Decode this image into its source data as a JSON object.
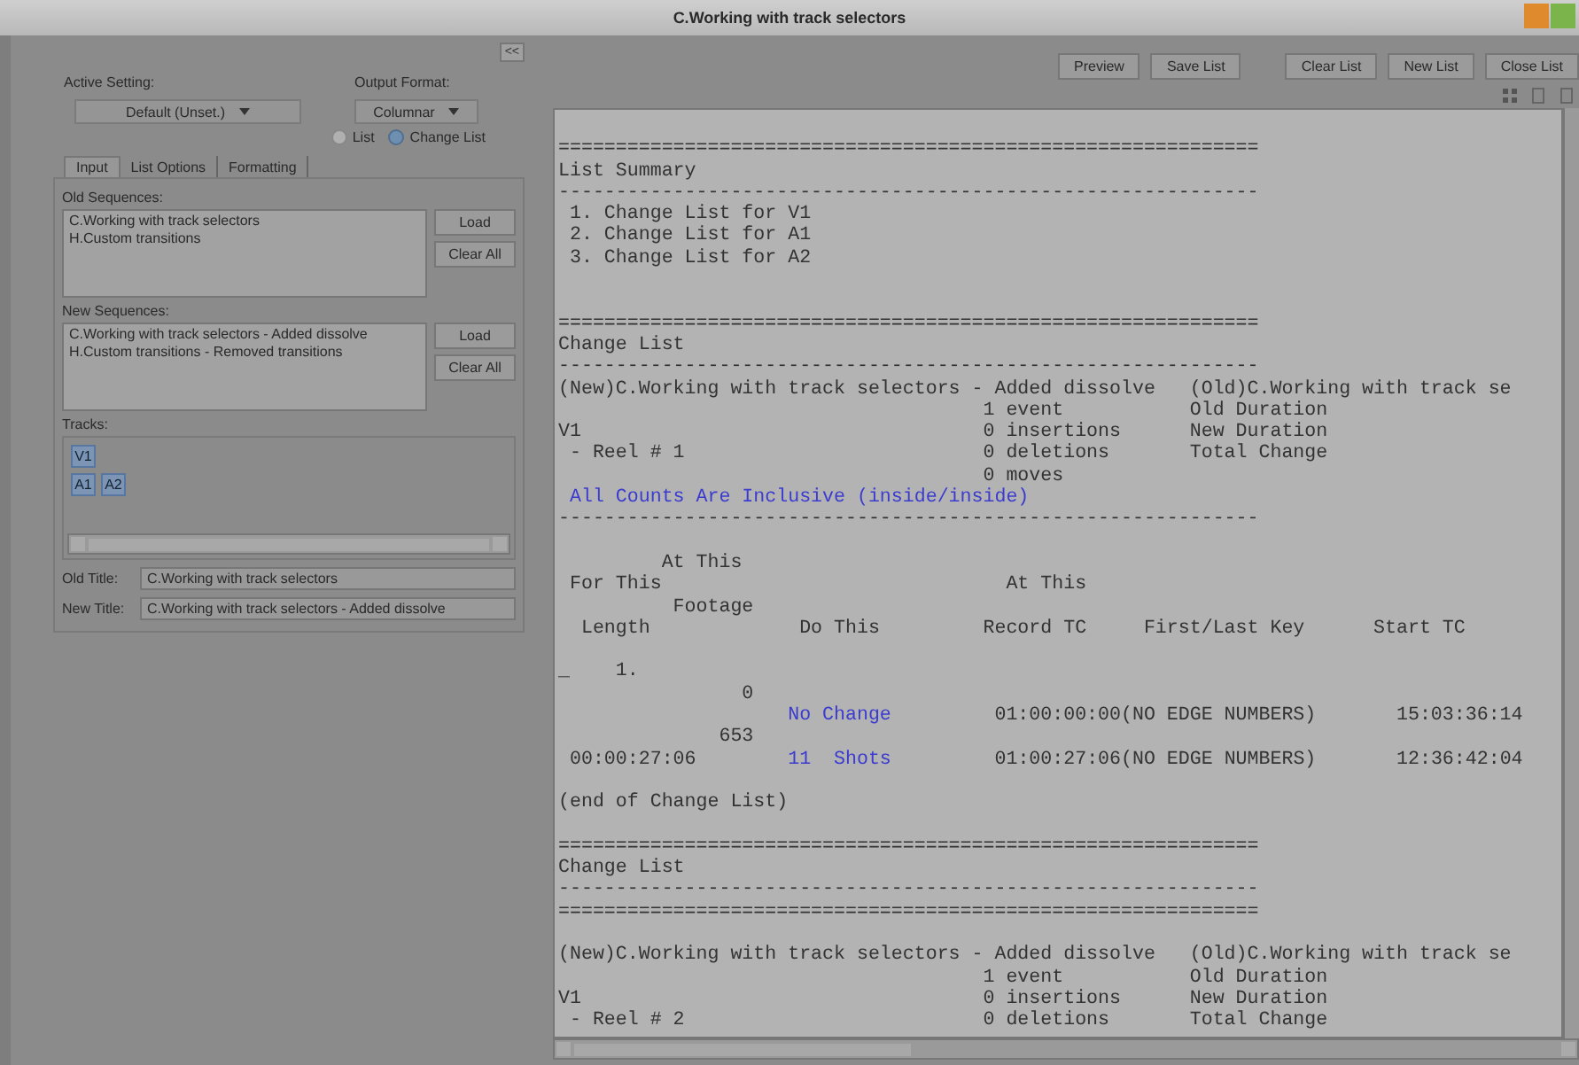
{
  "window": {
    "title": "C.Working with track selectors"
  },
  "collapse_button": "<<",
  "settings": [
    {
      "label": "Active Setting:",
      "value": "Default (Unset.)"
    },
    {
      "label": "Output Format:",
      "value": "Columnar"
    }
  ],
  "radios": [
    {
      "label": "List",
      "selected": false
    },
    {
      "label": "Change List",
      "selected": true
    }
  ],
  "tabs": [
    {
      "label": "Input",
      "selected": true
    },
    {
      "label": "List Options",
      "selected": false
    },
    {
      "label": "Formatting",
      "selected": false
    }
  ],
  "sequences": [
    {
      "label": "Old Sequences:",
      "items": [
        "C.Working with track selectors",
        "H.Custom transitions"
      ],
      "buttons": [
        "Load",
        "Clear All"
      ]
    },
    {
      "label": "New Sequences:",
      "items": [
        "C.Working with track selectors - Added dissolve",
        "H.Custom transitions - Removed transitions"
      ],
      "buttons": [
        "Load",
        "Clear All"
      ]
    }
  ],
  "tracks": {
    "label": "Tracks:",
    "rows": [
      [
        {
          "label": "V1",
          "selected": true
        }
      ],
      [
        {
          "label": "A1",
          "selected": true
        },
        {
          "label": "A2",
          "selected": true
        }
      ]
    ]
  },
  "titles": [
    {
      "label": "Old Title:",
      "value": "C.Working with track selectors"
    },
    {
      "label": "New Title:",
      "value": "C.Working with track selectors - Added dissolve"
    }
  ],
  "toolbar": {
    "left": [
      "Preview",
      "Save List"
    ],
    "right": [
      "Clear List",
      "New List",
      "Close List"
    ]
  },
  "report": {
    "lines": [
      {
        "kind": "blank"
      },
      {
        "kind": "text",
        "segments": [
          {
            "text": "=============================================================",
            "kind": "plain"
          }
        ]
      },
      {
        "kind": "text",
        "segments": [
          {
            "text": "List Summary",
            "kind": "plain"
          }
        ]
      },
      {
        "kind": "text",
        "segments": [
          {
            "text": "-------------------------------------------------------------",
            "kind": "plain"
          }
        ]
      },
      {
        "kind": "text",
        "segments": [
          {
            "text": " 1. Change List for V1",
            "kind": "plain"
          }
        ]
      },
      {
        "kind": "text",
        "segments": [
          {
            "text": " 2. Change List for A1",
            "kind": "plain"
          }
        ]
      },
      {
        "kind": "text",
        "segments": [
          {
            "text": " 3. Change List for A2",
            "kind": "plain"
          }
        ]
      },
      {
        "kind": "blank"
      },
      {
        "kind": "blank"
      },
      {
        "kind": "text",
        "segments": [
          {
            "text": "=============================================================",
            "kind": "plain"
          }
        ]
      },
      {
        "kind": "text",
        "segments": [
          {
            "text": "Change List",
            "kind": "plain"
          }
        ]
      },
      {
        "kind": "text",
        "segments": [
          {
            "text": "-------------------------------------------------------------",
            "kind": "plain"
          }
        ]
      },
      {
        "kind": "text",
        "segments": [
          {
            "text": "(New)C.Working with track selectors - Added dissolve   (Old)C.Working with track se",
            "kind": "plain"
          }
        ]
      },
      {
        "kind": "text",
        "segments": [
          {
            "text": "                                     1 event           Old Duration",
            "kind": "plain"
          }
        ]
      },
      {
        "kind": "text",
        "segments": [
          {
            "text": "V1                                   0 insertions      New Duration",
            "kind": "plain"
          }
        ]
      },
      {
        "kind": "text",
        "segments": [
          {
            "text": " - Reel # 1                          0 deletions       Total Change",
            "kind": "plain"
          }
        ]
      },
      {
        "kind": "text",
        "segments": [
          {
            "text": "                                     0 moves",
            "kind": "plain"
          }
        ]
      },
      {
        "kind": "text",
        "segments": [
          {
            "text": " All Counts Are Inclusive (inside/inside)",
            "kind": "highlight"
          }
        ]
      },
      {
        "kind": "text",
        "segments": [
          {
            "text": "-------------------------------------------------------------",
            "kind": "plain"
          }
        ]
      },
      {
        "kind": "blank"
      },
      {
        "kind": "text",
        "segments": [
          {
            "text": "         At This",
            "kind": "plain"
          }
        ]
      },
      {
        "kind": "text",
        "segments": [
          {
            "text": " For This                              At This",
            "kind": "plain"
          }
        ]
      },
      {
        "kind": "text",
        "segments": [
          {
            "text": "          Footage",
            "kind": "plain"
          }
        ]
      },
      {
        "kind": "text",
        "segments": [
          {
            "text": "  Length             Do This         Record TC     First/Last Key      Start TC",
            "kind": "plain"
          }
        ]
      },
      {
        "kind": "blank"
      },
      {
        "kind": "text",
        "segments": [
          {
            "text": "_    1.",
            "kind": "plain"
          }
        ]
      },
      {
        "kind": "text",
        "segments": [
          {
            "text": "                0",
            "kind": "plain"
          }
        ]
      },
      {
        "kind": "text",
        "segments": [
          {
            "text": "                    No Change",
            "kind": "highlight"
          },
          {
            "text": "         01:00:00:00(NO EDGE NUMBERS)       15:03:36:14",
            "kind": "plain"
          }
        ]
      },
      {
        "kind": "text",
        "segments": [
          {
            "text": "              653",
            "kind": "plain"
          }
        ]
      },
      {
        "kind": "text",
        "segments": [
          {
            "text": " 00:00:27:06        ",
            "kind": "plain"
          },
          {
            "text": "11  Shots",
            "kind": "highlight"
          },
          {
            "text": "         01:00:27:06(NO EDGE NUMBERS)       12:36:42:04",
            "kind": "plain"
          }
        ]
      },
      {
        "kind": "blank"
      },
      {
        "kind": "text",
        "segments": [
          {
            "text": "(end of Change List)",
            "kind": "plain"
          }
        ]
      },
      {
        "kind": "blank"
      },
      {
        "kind": "text",
        "segments": [
          {
            "text": "=============================================================",
            "kind": "plain"
          }
        ]
      },
      {
        "kind": "text",
        "segments": [
          {
            "text": "Change List",
            "kind": "plain"
          }
        ]
      },
      {
        "kind": "text",
        "segments": [
          {
            "text": "-------------------------------------------------------------",
            "kind": "plain"
          }
        ]
      },
      {
        "kind": "text",
        "segments": [
          {
            "text": "=============================================================",
            "kind": "plain"
          }
        ]
      },
      {
        "kind": "blank"
      },
      {
        "kind": "text",
        "segments": [
          {
            "text": "(New)C.Working with track selectors - Added dissolve   (Old)C.Working with track se",
            "kind": "plain"
          }
        ]
      },
      {
        "kind": "text",
        "segments": [
          {
            "text": "                                     1 event           Old Duration",
            "kind": "plain"
          }
        ]
      },
      {
        "kind": "text",
        "segments": [
          {
            "text": "V1                                   0 insertions      New Duration",
            "kind": "plain"
          }
        ]
      },
      {
        "kind": "text",
        "segments": [
          {
            "text": " - Reel # 2                          0 deletions       Total Change",
            "kind": "plain"
          }
        ]
      }
    ]
  }
}
